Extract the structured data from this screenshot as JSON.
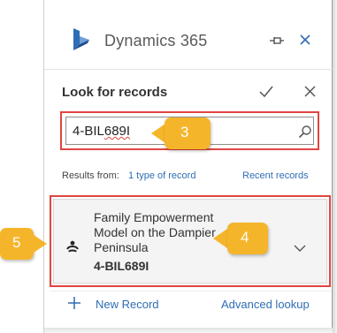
{
  "header": {
    "brand": "Dynamics 365"
  },
  "lookup": {
    "title": "Look for records",
    "search_value_main": "4-BIL",
    "search_value_misspelled": "689I"
  },
  "results": {
    "from_label": "Results from:",
    "type_link": "1 type of record",
    "recent_link": "Recent records"
  },
  "record": {
    "name": "Family Empowerment Model on the Dampier Peninsula",
    "id": "4-BIL689I"
  },
  "footer": {
    "new_record": "New Record",
    "advanced_lookup": "Advanced lookup"
  },
  "callouts": {
    "search": "3",
    "expand": "4",
    "record_icon": "5"
  },
  "colors": {
    "accent": "#2f6db5",
    "highlight": "#e0453f",
    "callout": "#f5b52a"
  }
}
